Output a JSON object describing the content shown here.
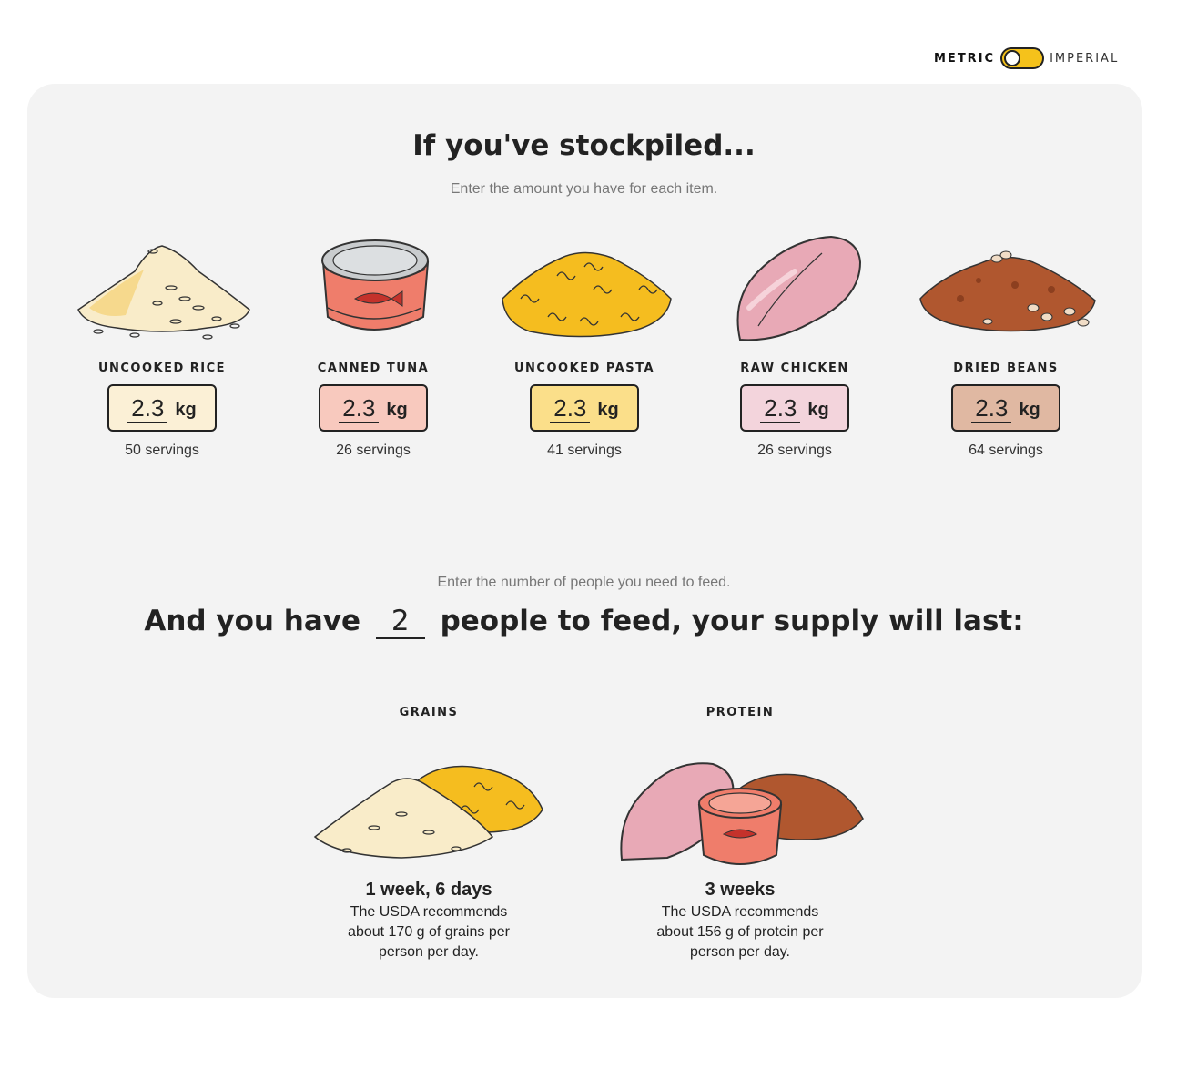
{
  "unit_toggle": {
    "left_label": "METRIC",
    "right_label": "IMPERIAL",
    "toggle_color": "#f5c21b"
  },
  "header": {
    "title": "If you've stockpiled...",
    "subtitle": "Enter the amount you have for each item."
  },
  "items": [
    {
      "name": "UNCOOKED RICE",
      "amount": "2.3",
      "unit": "kg",
      "servings": "50 servings",
      "box_color": "#fbf0d6",
      "icon": "rice-pile-icon"
    },
    {
      "name": "CANNED TUNA",
      "amount": "2.3",
      "unit": "kg",
      "servings": "26 servings",
      "box_color": "#f8c9be",
      "icon": "tuna-can-icon"
    },
    {
      "name": "UNCOOKED PASTA",
      "amount": "2.3",
      "unit": "kg",
      "servings": "41 servings",
      "box_color": "#fbdf8a",
      "icon": "pasta-pile-icon"
    },
    {
      "name": "RAW CHICKEN",
      "amount": "2.3",
      "unit": "kg",
      "servings": "26 servings",
      "box_color": "#f3d4dc",
      "icon": "chicken-breast-icon"
    },
    {
      "name": "DRIED BEANS",
      "amount": "2.3",
      "unit": "kg",
      "servings": "64 servings",
      "box_color": "#e0b8a2",
      "icon": "beans-pile-icon"
    }
  ],
  "people": {
    "hint": "Enter the number of people you need to feed.",
    "before": "And you have",
    "count": "2",
    "after": "people to feed, your supply will last:"
  },
  "results": [
    {
      "label": "GRAINS",
      "duration": "1 week, 6 days",
      "note": "The USDA recommends about 170 g of grains per person per day.",
      "icon": "grains-combo-icon"
    },
    {
      "label": "PROTEIN",
      "duration": "3 weeks",
      "note": "The USDA recommends about 156 g of protein per person per day.",
      "icon": "protein-combo-icon"
    }
  ]
}
